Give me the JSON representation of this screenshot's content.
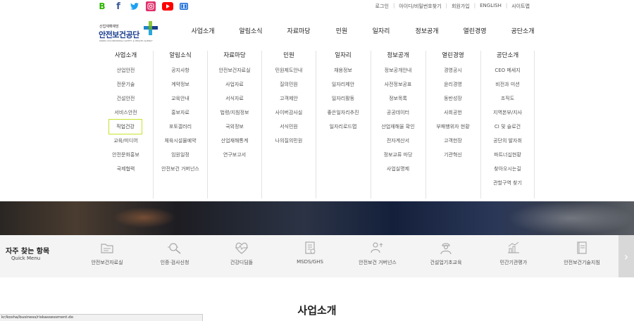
{
  "social": [
    {
      "name": "blog-icon",
      "glyph": "B"
    },
    {
      "name": "facebook-icon",
      "glyph": "f"
    },
    {
      "name": "twitter-icon",
      "glyph": "🐦"
    },
    {
      "name": "instagram-icon",
      "glyph": "◎"
    },
    {
      "name": "youtube-icon",
      "glyph": "▶"
    },
    {
      "name": "ebook-icon",
      "glyph": "▭"
    }
  ],
  "util_links": [
    "로그인",
    "아이디/비밀번호찾기",
    "회원가입",
    "ENGLISH",
    "사이트맵"
  ],
  "logo": {
    "sub": "산업재해예방",
    "main": "안전보건공단",
    "eng": "KOREA OCCUPATIONAL SAFETY & HEALTH AGENCY"
  },
  "gnb": [
    "사업소개",
    "알림소식",
    "자료마당",
    "민원",
    "일자리",
    "정보공개",
    "열린경영",
    "공단소개"
  ],
  "mega": [
    {
      "head": "사업소개",
      "items": [
        "산업안전",
        "전문기술",
        "건설안전",
        "서비스안전",
        "직업건강",
        "교육/미디어",
        "안전문화홍보",
        "국제협력"
      ]
    },
    {
      "head": "알림소식",
      "items": [
        "공지사항",
        "계약정보",
        "교육안내",
        "홍보자료",
        "포토갤러리",
        "체육시설물예약",
        "임원일정",
        "안전보건 거버넌스"
      ]
    },
    {
      "head": "자료마당",
      "items": [
        "안전보건자료실",
        "사업자료",
        "서식자료",
        "법령/지침정보",
        "국외정보",
        "산업재해통계",
        "연구보고서"
      ]
    },
    {
      "head": "민원",
      "items": [
        "민원제도안내",
        "질의민원",
        "고객제안",
        "사이버감사실",
        "서식민원",
        "나의질의민원"
      ]
    },
    {
      "head": "일자리",
      "items": [
        "채용정보",
        "일자리제안",
        "일자리활동",
        "좋은일자리추진",
        "일자리로드맵"
      ]
    },
    {
      "head": "정보공개",
      "items": [
        "정보공개안내",
        "사전정보공표",
        "정보목록",
        "공공데이터",
        "산업재해율 확인",
        "전자계산서",
        "정보교류 마당",
        "사업실명제"
      ]
    },
    {
      "head": "열린경영",
      "items": [
        "경영공시",
        "윤리경영",
        "동반성장",
        "사회공헌",
        "부패행위자 현황",
        "고객헌장",
        "기관혁신"
      ]
    },
    {
      "head": "공단소개",
      "items": [
        "CEO 메세지",
        "비전과 미션",
        "조직도",
        "지역본부/지사",
        "CI 및 슬로건",
        "공단의 발자취",
        "파트너십현황",
        "찾아오시는길",
        "관할구역 찾기"
      ]
    }
  ],
  "selected_menu_item": "직업건강",
  "quick": {
    "title": "자주 찾는 항목",
    "subtitle": "Quick Menu",
    "items": [
      {
        "label": "안전보건자료실",
        "icon": "folder-icon"
      },
      {
        "label": "인증·검사신청",
        "icon": "magnifier-icon"
      },
      {
        "label": "건강디딤돌",
        "icon": "heartbeat-icon"
      },
      {
        "label": "MSDS/GHS",
        "icon": "document-icon"
      },
      {
        "label": "안전보건 거버넌스",
        "icon": "people-icon"
      },
      {
        "label": "건설업기초교육",
        "icon": "worker-icon"
      },
      {
        "label": "민간기관평가",
        "icon": "chart-icon"
      },
      {
        "label": "안전보건기술지침",
        "icon": "book-icon"
      }
    ],
    "next": "›"
  },
  "content_title": "사업소개",
  "status_url": "kr/kosha/business/riskassessment.do",
  "colors": {
    "brand_blue": "#1a3d8f",
    "brand_green": "#8cc63f",
    "highlight": "#c6e22c"
  }
}
